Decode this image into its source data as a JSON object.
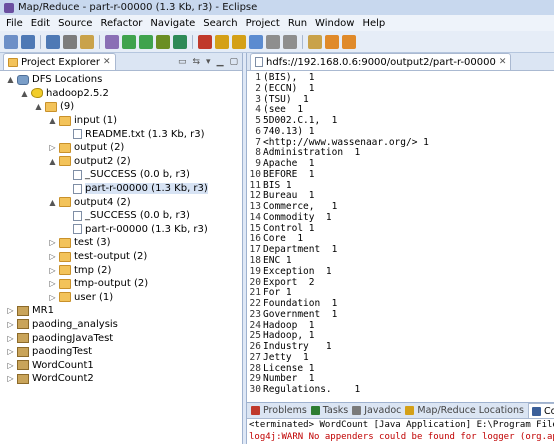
{
  "window": {
    "title": "Map/Reduce - part-r-00000 (1.3 Kb, r3) - Eclipse"
  },
  "menu": [
    "File",
    "Edit",
    "Source",
    "Refactor",
    "Navigate",
    "Search",
    "Project",
    "Run",
    "Window",
    "Help"
  ],
  "toolbar": {
    "icons": [
      "new-icon",
      "save-icon",
      "save-all-icon",
      "print-icon",
      "build-icon",
      "perspective-icon",
      "refresh-icon",
      "run-config-icon",
      "debug-icon",
      "run-icon",
      "external-tools-icon",
      "new-java-project-icon",
      "new-package-icon",
      "new-class-icon",
      "open-type-icon",
      "search-icon",
      "annotation-icon",
      "back-icon",
      "forward-icon"
    ]
  },
  "project_explorer": {
    "tab_label": "Project Explorer",
    "tree": [
      {
        "indent": 0,
        "toggle": "▲",
        "icon": "db",
        "label": "DFS Locations"
      },
      {
        "indent": 1,
        "toggle": "▲",
        "icon": "elephant",
        "label": "hadoop2.5.2"
      },
      {
        "indent": 2,
        "toggle": "▲",
        "icon": "folder",
        "label": "(9)"
      },
      {
        "indent": 3,
        "toggle": "▲",
        "icon": "folder",
        "label": "input (1)"
      },
      {
        "indent": 4,
        "toggle": "",
        "icon": "file",
        "label": "README.txt (1.3 Kb, r3)"
      },
      {
        "indent": 3,
        "toggle": "▷",
        "icon": "folder",
        "label": "output (2)"
      },
      {
        "indent": 3,
        "toggle": "▲",
        "icon": "folder",
        "label": "output2 (2)"
      },
      {
        "indent": 4,
        "toggle": "",
        "icon": "file",
        "label": "_SUCCESS (0.0 b, r3)"
      },
      {
        "indent": 4,
        "toggle": "",
        "icon": "file",
        "label": "part-r-00000 (1.3 Kb, r3)",
        "selected": true
      },
      {
        "indent": 3,
        "toggle": "▲",
        "icon": "folder",
        "label": "output4 (2)"
      },
      {
        "indent": 4,
        "toggle": "",
        "icon": "file",
        "label": "_SUCCESS (0.0 b, r3)"
      },
      {
        "indent": 4,
        "toggle": "",
        "icon": "file",
        "label": "part-r-00000 (1.3 Kb, r3)"
      },
      {
        "indent": 3,
        "toggle": "▷",
        "icon": "folder",
        "label": "test (3)"
      },
      {
        "indent": 3,
        "toggle": "▷",
        "icon": "folder",
        "label": "test-output (2)"
      },
      {
        "indent": 3,
        "toggle": "▷",
        "icon": "folder",
        "label": "tmp (2)"
      },
      {
        "indent": 3,
        "toggle": "▷",
        "icon": "folder",
        "label": "tmp-output (2)"
      },
      {
        "indent": 3,
        "toggle": "▷",
        "icon": "folder",
        "label": "user (1)"
      },
      {
        "indent": 0,
        "toggle": "▷",
        "icon": "project",
        "label": "MR1"
      },
      {
        "indent": 0,
        "toggle": "▷",
        "icon": "project",
        "label": "paoding_analysis"
      },
      {
        "indent": 0,
        "toggle": "▷",
        "icon": "project",
        "label": "paodingJavaTest"
      },
      {
        "indent": 0,
        "toggle": "▷",
        "icon": "project",
        "label": "paodingTest"
      },
      {
        "indent": 0,
        "toggle": "▷",
        "icon": "project",
        "label": "WordCount1"
      },
      {
        "indent": 0,
        "toggle": "▷",
        "icon": "project",
        "label": "WordCount2"
      }
    ]
  },
  "editor": {
    "tab_label": "hdfs://192.168.0.6:9000/output2/part-r-00000",
    "lines": [
      "(BIS),  1",
      "(ECCN)  1",
      "(TSU)  1",
      "(see  1",
      "5D002.C.1,  1",
      "740.13) 1",
      "<http://www.wassenaar.org/> 1",
      "Administration  1",
      "Apache  1",
      "BEFORE  1",
      "BIS 1",
      "Bureau  1",
      "Commerce,   1",
      "Commodity  1",
      "Control 1",
      "Core  1",
      "Department  1",
      "ENC 1",
      "Exception  1",
      "Export  2",
      "For 1",
      "Foundation  1",
      "Government  1",
      "Hadoop  1",
      "Hadoop, 1",
      "Industry   1",
      "Jetty  1",
      "License 1",
      "Number  1",
      "Regulations.    1"
    ]
  },
  "bottom": {
    "tabs": [
      "Problems",
      "Tasks",
      "Javadoc",
      "Map/Reduce Locations",
      "Conso"
    ],
    "terminated": "<terminated> WordCount [Java Application] E:\\Program Files\\Java\\jre7\\bin\\",
    "warn": "log4j:WARN No appenders could be found for logger (org.apache.h"
  }
}
